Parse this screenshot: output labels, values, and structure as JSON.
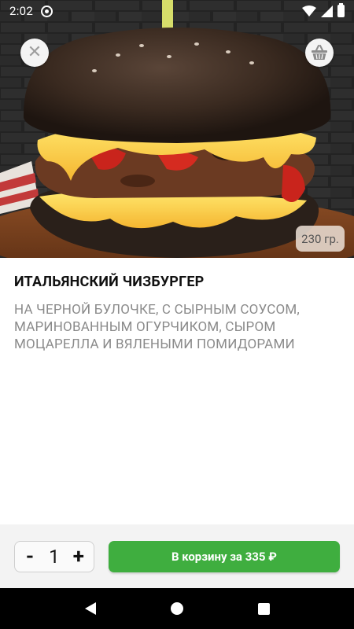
{
  "status_bar": {
    "time": "2:02",
    "icons": [
      "app-notification-icon",
      "wifi-icon",
      "signal-icon",
      "battery-icon"
    ]
  },
  "hero": {
    "image": "burger-photo",
    "close_icon": "close-icon",
    "basket_icon": "basket-icon",
    "weight": "230 гр."
  },
  "product": {
    "title": "ИТАЛЬЯНСКИЙ ЧИЗБУРГЕР",
    "description": "НА ЧЕРНОЙ БУЛОЧКЕ, С СЫРНЫМ СОУСОМ, МАРИНОВАННЫМ ОГУРЧИКОМ, СЫРОМ МОЦАРЕЛЛА И ВЯЛЕНЫМИ ПОМИДОРАМИ"
  },
  "cart": {
    "minus_label": "-",
    "quantity": "1",
    "plus_label": "+",
    "add_button_label": "В корзину за 335 ₽",
    "accent_color": "#3fae3f"
  },
  "nav_bar": {
    "icons": [
      "back-icon",
      "home-icon",
      "recents-icon"
    ]
  }
}
